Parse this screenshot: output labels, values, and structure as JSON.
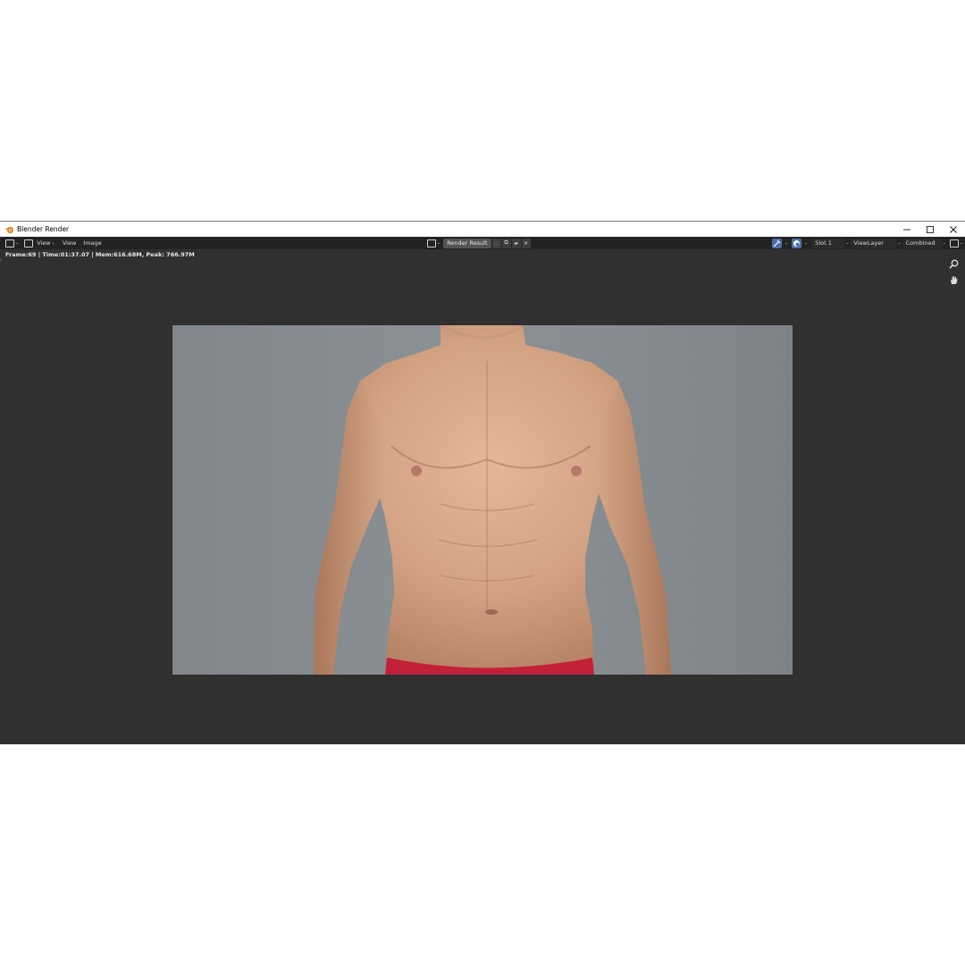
{
  "window": {
    "title": "Blender Render"
  },
  "header": {
    "menus": [
      "View",
      "View",
      "Image"
    ],
    "image_name": "Render Result",
    "slot": "Slot 1",
    "view_layer": "ViewLayer",
    "pass": "Combined"
  },
  "status": {
    "text": "Frame:69 | Time:01:37.07 | Mem:616.68M, Peak: 766.97M"
  },
  "icons": {
    "app": "blender-logo-icon",
    "minimize": "minimize-icon",
    "maximize": "maximize-icon",
    "close": "close-icon",
    "zoom": "zoom-icon",
    "pan": "hand-pan-icon"
  },
  "colors": {
    "accent": "#4a6fa5",
    "panel": "#303030",
    "header": "#232323"
  }
}
